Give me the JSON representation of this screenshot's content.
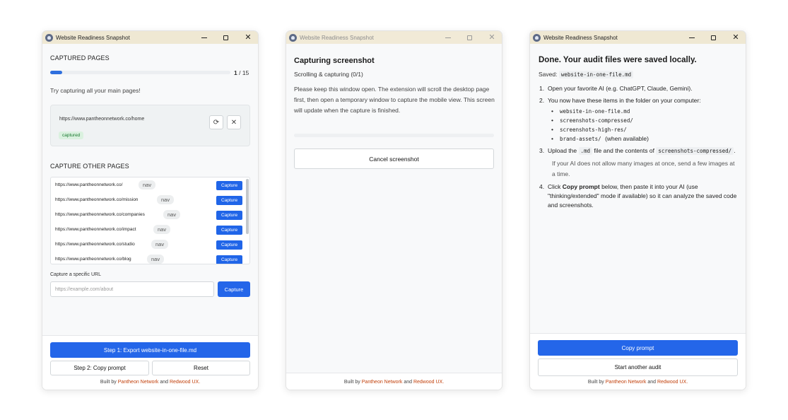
{
  "window_title": "Website Readiness Snapshot",
  "colors": {
    "primary": "#2466e9",
    "link": "#c2410c",
    "captured_bg": "#daf1df",
    "captured_text": "#1b7a31"
  },
  "icons": [
    "app-logo-icon",
    "minimize-icon",
    "maximize-icon",
    "close-icon",
    "refresh-icon",
    "remove-icon"
  ],
  "w1": {
    "captured_heading": "CAPTURED PAGES",
    "progress": {
      "done": "1",
      "total": "/ 15",
      "fraction": 0.0667
    },
    "hint": "Try capturing all your main pages!",
    "captured_url": "https://www.pantheonnetwork.co/home",
    "captured_badge": "captured",
    "other_heading": "CAPTURE OTHER PAGES",
    "pages": [
      {
        "url": "https://www.pantheonnetwork.co/",
        "tag": "nav",
        "btn": "Capture"
      },
      {
        "url": "https://www.pantheonnetwork.co/mission",
        "tag": "nav",
        "btn": "Capture"
      },
      {
        "url": "https://www.pantheonnetwork.co/companies",
        "tag": "nav",
        "btn": "Capture"
      },
      {
        "url": "https://www.pantheonnetwork.co/impact",
        "tag": "nav",
        "btn": "Capture"
      },
      {
        "url": "https://www.pantheonnetwork.co/studio",
        "tag": "nav",
        "btn": "Capture"
      },
      {
        "url": "https://www.pantheonnetwork.co/blog",
        "tag": "nav",
        "btn": "Capture"
      }
    ],
    "specific_label": "Capture a specific URL",
    "specific_placeholder": "https://example.com/about",
    "specific_btn": "Capture",
    "export_btn": "Step 1: Export website-in-one-file.md",
    "copy_btn": "Step 2: Copy prompt",
    "reset_btn": "Reset"
  },
  "w2": {
    "heading": "Capturing screenshot",
    "status": "Scrolling & capturing (0/1)",
    "body": "Please keep this window open. The extension will scroll the desktop page first, then open a temporary window to capture the mobile view. This screen will update when the capture is finished.",
    "cancel_btn": "Cancel screenshot"
  },
  "w3": {
    "heading": "Done. Your audit files were saved locally.",
    "saved_label": "Saved:",
    "saved_file": "website-in-one-file.md",
    "step1": "Open your favorite AI (e.g. ChatGPT, Claude, Gemini).",
    "step2": "You now have these items in the folder on your computer:",
    "items": [
      {
        "name": "website-in-one-file.md",
        "suffix": ""
      },
      {
        "name": "screenshots-compressed/",
        "suffix": ""
      },
      {
        "name": "screenshots-high-res/",
        "suffix": ""
      },
      {
        "name": "brand-assets/",
        "suffix": "(when available)"
      }
    ],
    "step3_a": "Upload the",
    "step3_code1": ".md",
    "step3_b": "file and the contents of",
    "step3_code2": "screenshots-compressed/",
    "step3_c": ".",
    "step3_note": "If your AI does not allow many images at once, send a few images at a time.",
    "step4_a": "Click",
    "step4_bold": "Copy prompt",
    "step4_b": "below, then paste it into your AI (use \"thinking/extended\" mode if available) so it can analyze the saved code and screenshots.",
    "copy_btn": "Copy prompt",
    "start_btn": "Start another audit"
  },
  "footer": {
    "prefix": "Built by",
    "link1": "Pantheon Network",
    "and": "and",
    "link2": "Redwood UX."
  },
  "nums": [
    "1.",
    "2.",
    "3.",
    "4."
  ]
}
